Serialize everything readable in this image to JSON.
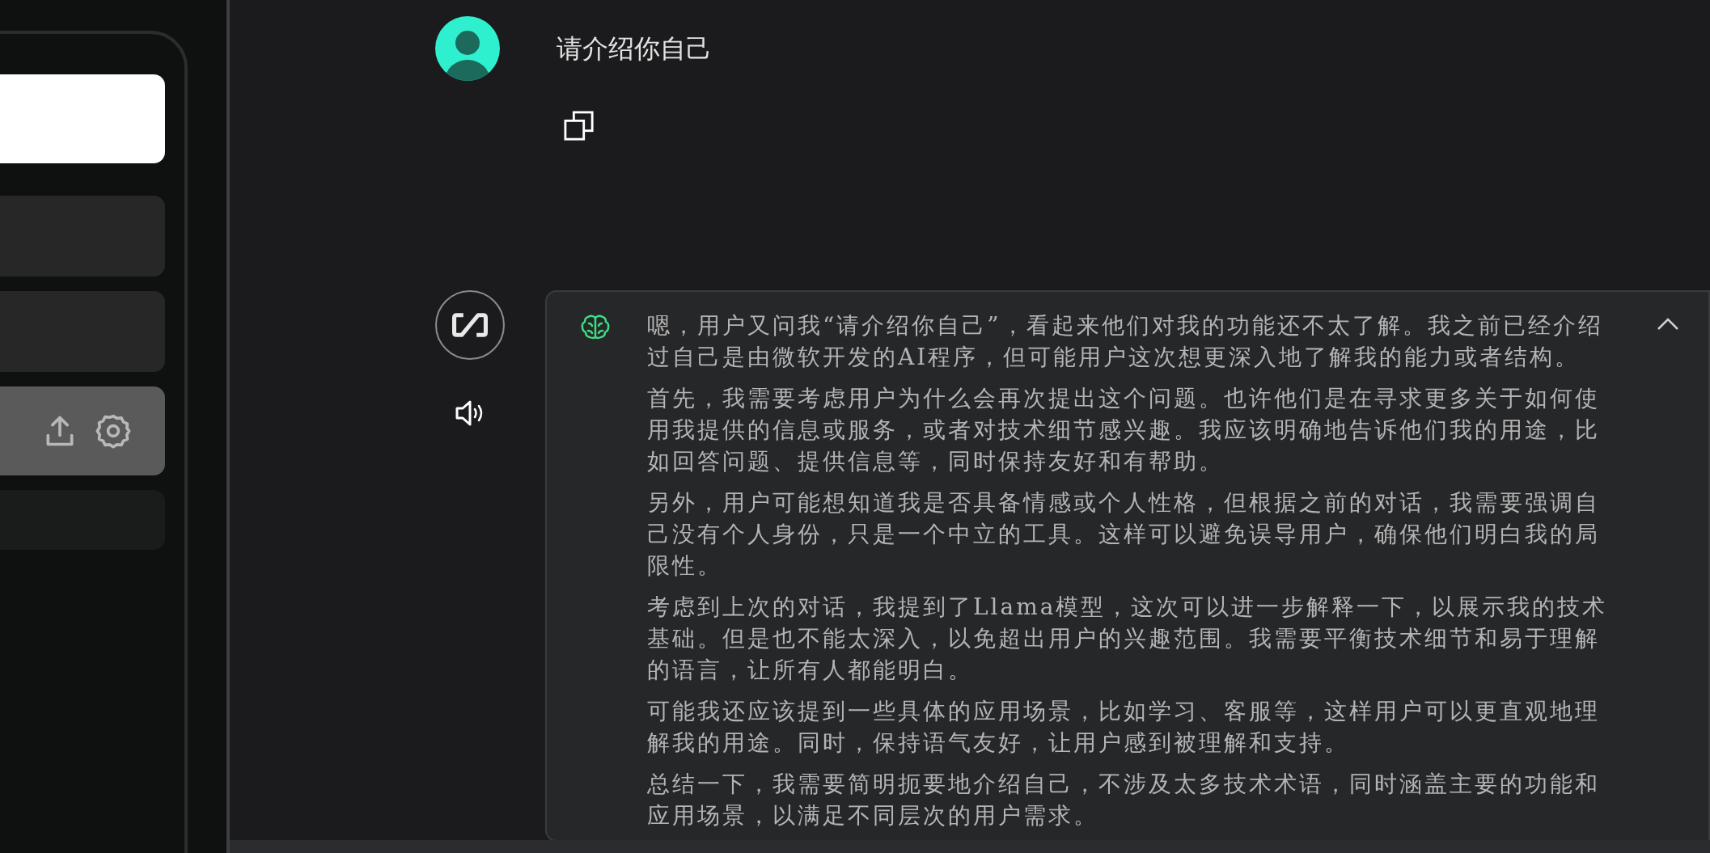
{
  "sidebar": {
    "items": [
      {
        "kind": "primary",
        "selected": false
      },
      {
        "kind": "plain",
        "selected": false
      },
      {
        "kind": "plain",
        "selected": false
      },
      {
        "kind": "actions",
        "selected": true
      },
      {
        "kind": "dim",
        "selected": false
      }
    ]
  },
  "user_message": {
    "text": "请介绍你自己"
  },
  "assistant_message": {
    "thinking_expanded": true,
    "paragraphs": [
      "嗯，用户又问我“请介绍你自己”，看起来他们对我的功能还不太了解。我之前已经介绍过自己是由微软开发的AI程序，但可能用户这次想更深入地了解我的能力或者结构。",
      "首先，我需要考虑用户为什么会再次提出这个问题。也许他们是在寻求更多关于如何使用我提供的信息或服务，或者对技术细节感兴趣。我应该明确地告诉他们我的用途，比如回答问题、提供信息等，同时保持友好和有帮助。",
      "另外，用户可能想知道我是否具备情感或个人性格，但根据之前的对话，我需要强调自己没有个人身份，只是一个中立的工具。这样可以避免误导用户，确保他们明白我的局限性。",
      "考虑到上次的对话，我提到了Llama模型，这次可以进一步解释一下，以展示我的技术基础。但是也不能太深入，以免超出用户的兴趣范围。我需要平衡技术细节和易于理解的语言，让所有人都能明白。",
      "可能我还应该提到一些具体的应用场景，比如学习、客服等，这样用户可以更直观地理解我的用途。同时，保持语气友好，让用户感到被理解和支持。",
      "总结一下，我需要简明扼要地介绍自己，不涉及太多技术术语，同时涵盖主要的功能和应用场景，以满足不同层次的用户需求。"
    ]
  }
}
